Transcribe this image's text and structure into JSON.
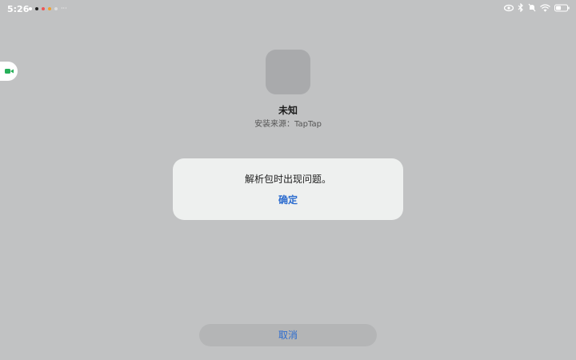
{
  "status_bar": {
    "time": "5:26",
    "notification_overflow": "···"
  },
  "app": {
    "name": "未知",
    "source": "安装来源：TapTap"
  },
  "dialog": {
    "message": "解析包时出现问题。",
    "ok_label": "确定"
  },
  "footer": {
    "cancel_label": "取消"
  },
  "colors": {
    "background": "#c1c2c3",
    "dialog": "#eef0ef",
    "accent": "#2c6ccf",
    "video_bubble": "#27b05a"
  }
}
